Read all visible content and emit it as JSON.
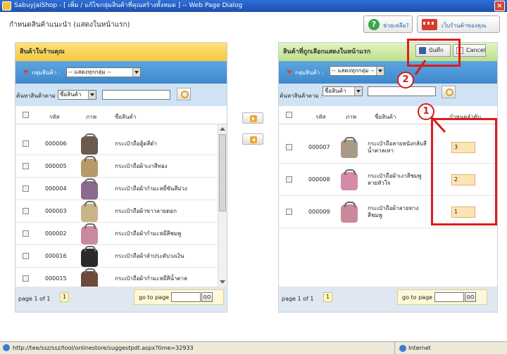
{
  "window": {
    "title": "SabuyjaiShop - [ เพิ่ม / แก้ไขกลุ่มสินค้าที่คุณสร้างทั้งหมด ] -- Web Page Dialog"
  },
  "page_title": "กำหนดสินค้าแนะนำ (แสดงในหน้าแรก)",
  "top_buttons": {
    "help": "ช่วยเหลือ?",
    "shop": "เว็บร้านค้าของคุณ"
  },
  "left_panel": {
    "header": "สินค้าในร้านคุณ",
    "group_label": "กลุ่มสินค้า :",
    "group_select": "-- แสดงทุกกลุ่ม --",
    "search_label": "ค้นหาสินค้าตาม :",
    "search_by": "ชื่อสินค้า",
    "search_value": "",
    "columns": {
      "code": "รหัส",
      "image": "ภาพ",
      "name": "ชื่อสินค้า"
    },
    "rows": [
      {
        "code": "000006",
        "name": "กระเป๋าถือฮู้ดสีดำ",
        "color": "#6b5a4e"
      },
      {
        "code": "000005",
        "name": "กระเป๋าถือผ้าเงาสีทอง",
        "color": "#b89a6a"
      },
      {
        "code": "000004",
        "name": "กระเป๋าถือผ้ากำมะหยี่ขันสีม่วง",
        "color": "#8a6a8e"
      },
      {
        "code": "000003",
        "name": "กระเป๋าถือผ้าขาวลายดอก",
        "color": "#c9b48a"
      },
      {
        "code": "000002",
        "name": "กระเป๋าถือผ้ากำมะหยี่สีชมพู",
        "color": "#c98aa0"
      },
      {
        "code": "000016",
        "name": "กระเป๋าถือผ้าลำประดับวงเงิน",
        "color": "#2b2b2b"
      },
      {
        "code": "000015",
        "name": "กระเป๋าถือผ้ากำมะหยี่สีน้ำตาล",
        "color": "#6e4a3a"
      }
    ],
    "pager": {
      "text": "page 1 of 1",
      "current": "1",
      "goto_label": "go to page",
      "goto_value": "",
      "go": "GO"
    }
  },
  "right_panel": {
    "header": "สินค้าที่ถูกเลือกแสดงในหน้าแรก",
    "save": "บันทึก",
    "cancel": "Cancel",
    "group_label": "กลุ่มสินค้า :",
    "group_select": "-- แสดงทุกกลุ่ม --",
    "search_label": "ค้นหาสินค้าตาม :",
    "search_by": "ชื่อสินค้า",
    "search_value": "",
    "columns": {
      "code": "รหัส",
      "image": "ภาพ",
      "name": "ชื่อสินค้า",
      "order": "กำหนดลำดับ"
    },
    "rows": [
      {
        "code": "000007",
        "name": "กระเป๋าถือลายหนังกลับสีน้ำตาลเทา",
        "order": "3",
        "color": "#a89a86"
      },
      {
        "code": "000008",
        "name": "กระเป๋าถือผ้าเงาสีชมพูลายหัวใจ",
        "order": "2",
        "color": "#d48aa8"
      },
      {
        "code": "000009",
        "name": "กระเป๋าถือผ้าลายทางสีชมพู",
        "order": "1",
        "color": "#c88a9a"
      }
    ],
    "pager": {
      "text": "page 1 of 1",
      "current": "1",
      "goto_label": "go to page",
      "goto_value": "",
      "go": "GO"
    }
  },
  "callouts": {
    "one": "1",
    "two": "2"
  },
  "status": {
    "url": "http://tee/ssz/ssz/tool/onlinestore/suggestpdt.aspx?time=32933",
    "zone": "Internet"
  }
}
